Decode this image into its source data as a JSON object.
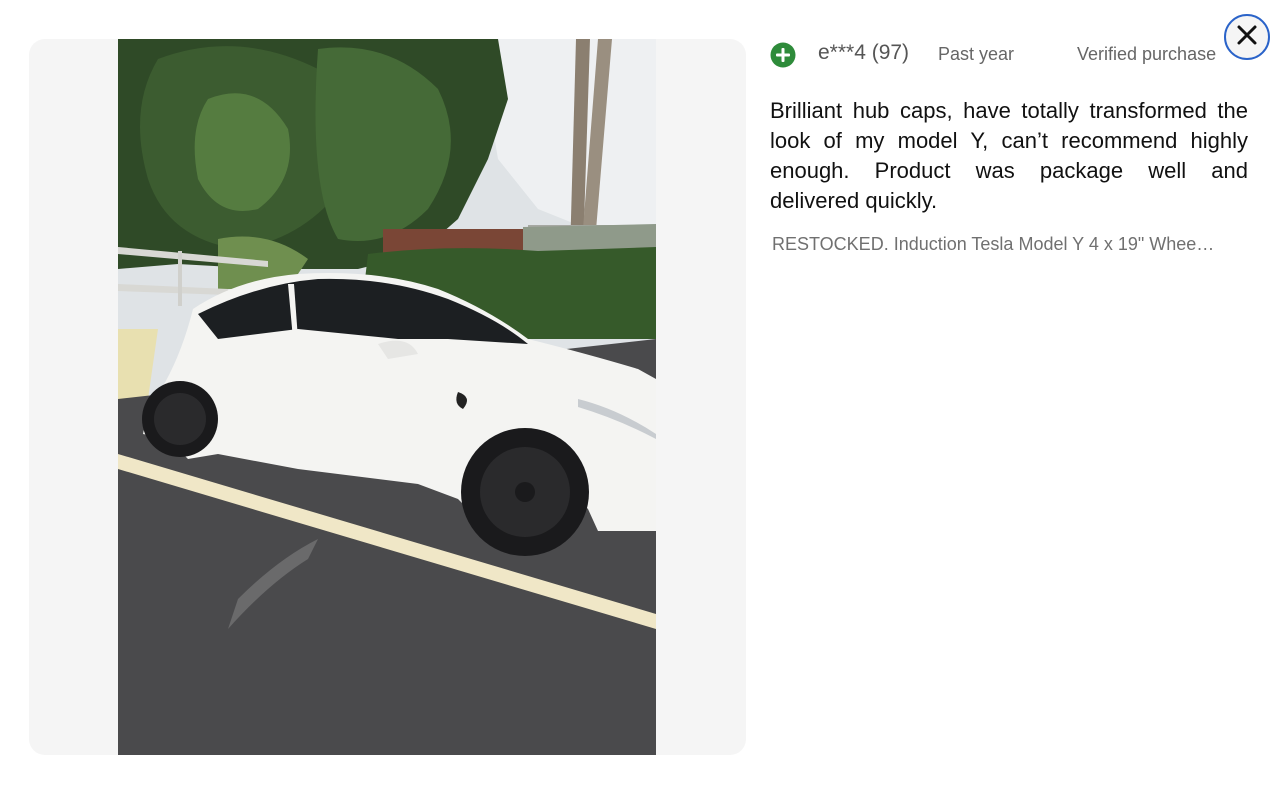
{
  "reviewer": {
    "name": "e***4 (97)",
    "badge_icon": "plus-circle-icon",
    "badge_color": "#2e8b3a"
  },
  "review": {
    "date": "Past year",
    "verified_label": "Verified purchase",
    "text": "Brilliant hub caps, have totally transformed the look of my model Y, can’t recommend highly enough. Product was package well and delivered quickly.",
    "product_title": "RESTOCKED. Induction Tesla Model Y 4 x 19\" Wheel…"
  },
  "photo": {
    "alt": "Review photo"
  },
  "close": {
    "icon": "close-icon",
    "accent_color": "#2a63c9"
  }
}
